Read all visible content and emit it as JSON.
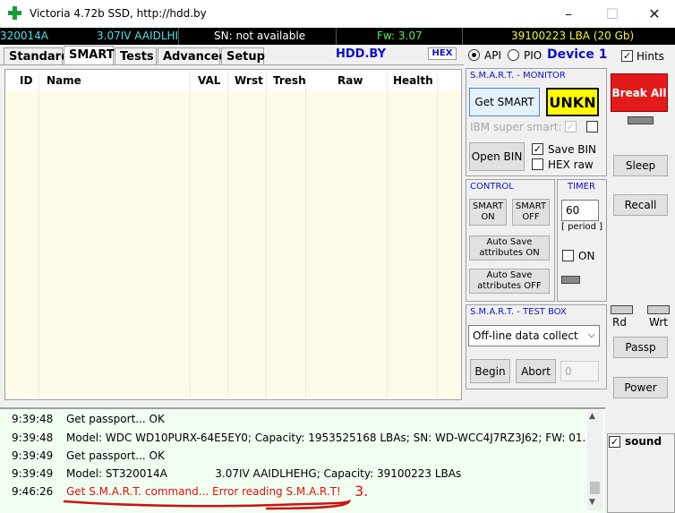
{
  "window": {
    "title": "Victoria 4.72b SSD, http://hdd.by",
    "minimize": "–",
    "maximize": "☐",
    "close": "✕"
  },
  "info": {
    "model": "320014A",
    "firmware_model": "3.07IV AAIDLHE",
    "sn": "SN: not available",
    "fw": "Fw: 3.07",
    "lba": "39100223 LBA (20 Gb)"
  },
  "tabs": [
    "Standard",
    "SMART",
    "Tests",
    "Advanced",
    "Setup"
  ],
  "header": {
    "site": "HDD.BY",
    "hex": "HEX",
    "api": "API",
    "pio": "PIO",
    "device": "Device 1",
    "hints": "Hints"
  },
  "table": {
    "columns": [
      "ID",
      "Name",
      "VAL",
      "Wrst",
      "Tresh",
      "Raw",
      "Health"
    ]
  },
  "smart_monitor": {
    "title": "S.M.A.R.T. - MONITOR",
    "get_smart": "Get SMART",
    "status": "UNKN",
    "ibm": "IBM super smart:",
    "open_bin": "Open BIN",
    "save_bin": "Save BIN",
    "hex_raw": "HEX raw"
  },
  "control": {
    "title": "CONTROL",
    "smart_on": "SMART ON",
    "smart_off": "SMART OFF",
    "autosave_on": "Auto Save attributes ON",
    "autosave_off": "Auto Save attributes OFF"
  },
  "timer": {
    "title": "TIMER",
    "value": "60",
    "period": "[ period ]",
    "on": "ON"
  },
  "testbox": {
    "title": "S.M.A.R.T. - TEST BOX",
    "selected": "Off-line data collect",
    "begin": "Begin",
    "abort": "Abort",
    "value": "0"
  },
  "right": {
    "break_all": "Break All",
    "sleep": "Sleep",
    "recall": "Recall",
    "rd": "Rd",
    "wrt": "Wrt",
    "passp": "Passp",
    "power": "Power",
    "sound": "sound"
  },
  "log": [
    {
      "time": "9:39:48",
      "text": "Get passport... OK",
      "error": false
    },
    {
      "time": "9:39:48",
      "text": "Model: WDC WD10PURX-64E5EY0; Capacity: 1953525168 LBAs; SN: WD-WCC4J7RZ3J62; FW: 01...",
      "error": false
    },
    {
      "time": "9:39:49",
      "text": "Get passport... OK",
      "error": false
    },
    {
      "time": "9:39:49",
      "text": "Model: ST320014A              3.07IV AAIDLHEHG; Capacity: 39100223 LBAs",
      "error": false
    },
    {
      "time": "9:46:26",
      "text": "Get S.M.A.R.T. command... Error reading S.M.A.R.T!",
      "error": true
    }
  ],
  "annotation": "3."
}
